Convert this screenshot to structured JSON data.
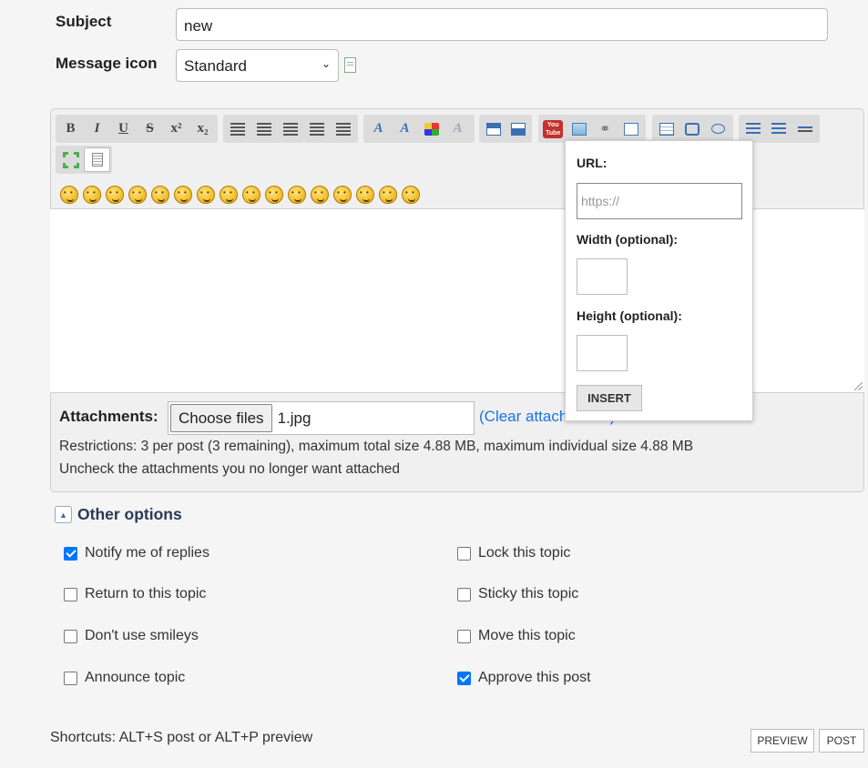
{
  "subject": {
    "label": "Subject",
    "value": "new"
  },
  "message_icon": {
    "label": "Message icon",
    "selected": "Standard"
  },
  "toolbar": {
    "format": [
      "B",
      "I",
      "U",
      "S",
      "x²",
      "x₂"
    ],
    "youtube": "You Tube"
  },
  "attachments": {
    "label": "Attachments:",
    "choose_label": "Choose files",
    "file_name": "1.jpg",
    "clear_link": "(Clear attachments)",
    "restrictions": "Restrictions: 3 per post (3 remaining), maximum total size 4.88 MB, maximum individual size 4.88 MB",
    "uncheck_note": "Uncheck the attachments you no longer want attached"
  },
  "insert_popup": {
    "url_label": "URL:",
    "url_placeholder": "https://",
    "width_label": "Width (optional):",
    "height_label": "Height (optional):",
    "insert_label": "INSERT"
  },
  "other_options": {
    "title": "Other options",
    "left": [
      {
        "label": "Notify me of replies",
        "checked": true
      },
      {
        "label": "Return to this topic",
        "checked": false
      },
      {
        "label": "Don't use smileys",
        "checked": false
      },
      {
        "label": "Announce topic",
        "checked": false
      }
    ],
    "right": [
      {
        "label": "Lock this topic",
        "checked": false
      },
      {
        "label": "Sticky this topic",
        "checked": false
      },
      {
        "label": "Move this topic",
        "checked": false
      },
      {
        "label": "Approve this post",
        "checked": true
      }
    ]
  },
  "footer": {
    "shortcuts": "Shortcuts: ALT+S post or ALT+P preview",
    "preview_label": "PREVIEW",
    "post_label": "POST"
  },
  "colors": {
    "accent": "#0075ff",
    "link": "#1a73e8",
    "popup_bg": "#ffffff"
  }
}
